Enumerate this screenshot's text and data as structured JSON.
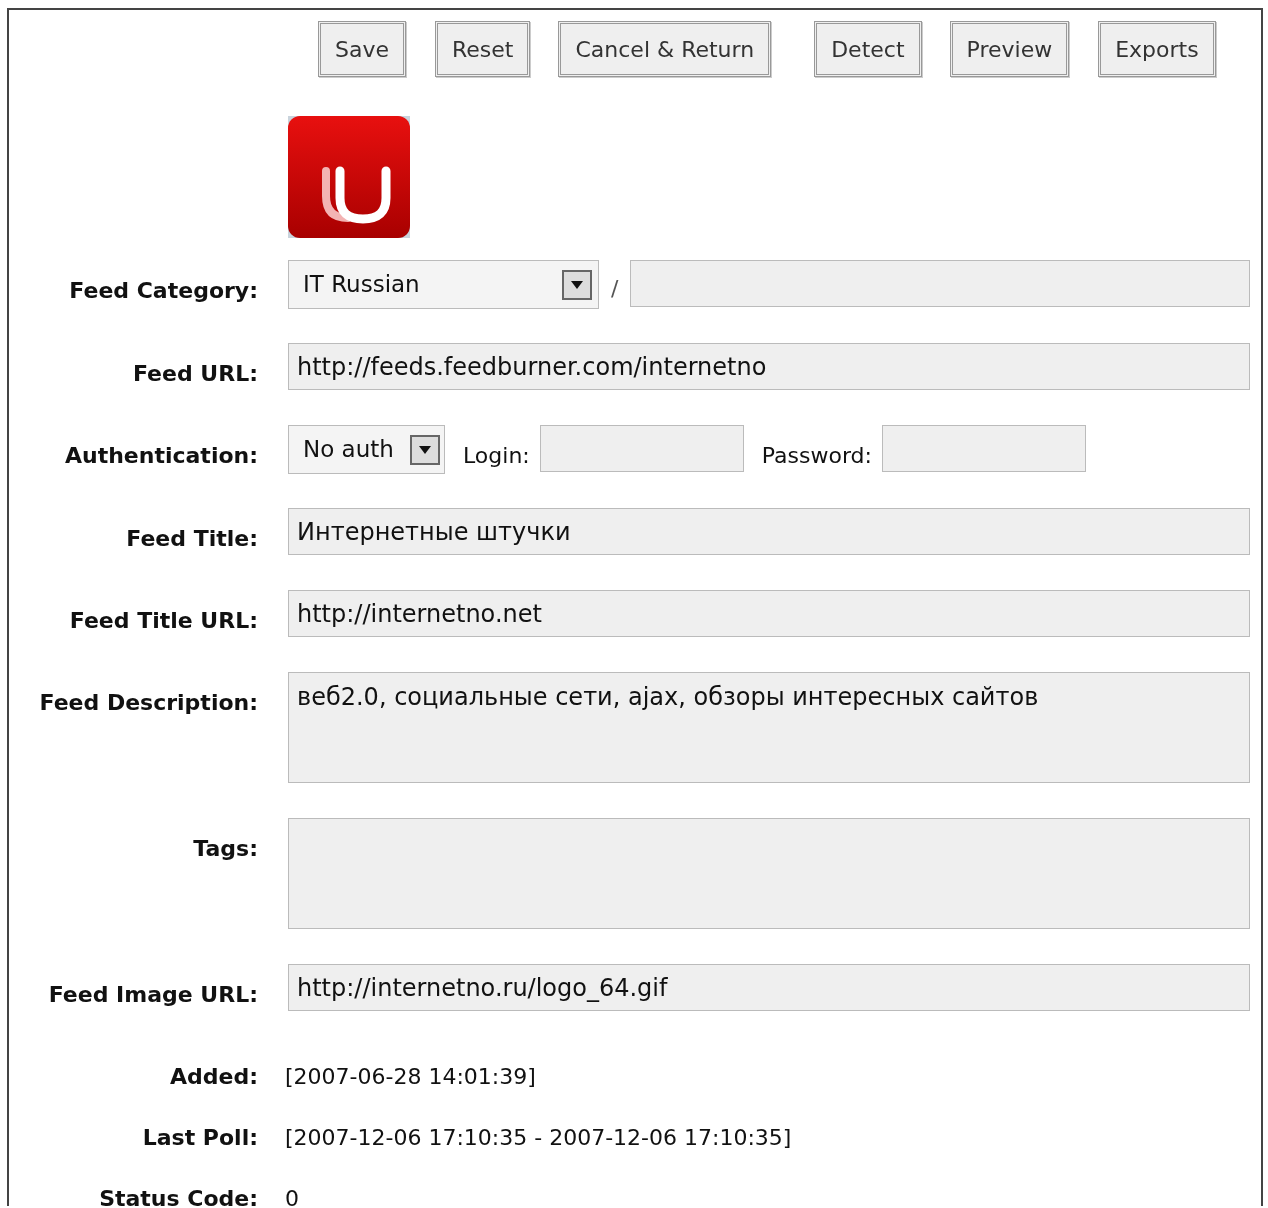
{
  "buttons": [
    "Save",
    "Reset",
    "Cancel & Return",
    "Detect",
    "Preview",
    "Exports"
  ],
  "fields": [
    {
      "kind": "category",
      "label": "Feed Category:",
      "value": "IT Russian",
      "separator": "/"
    },
    {
      "kind": "text",
      "label": "Feed URL:",
      "value": "http://feeds.feedburner.com/internetno"
    },
    {
      "kind": "auth",
      "label": "Authentication:",
      "value": "No auth",
      "login_label": "Login:",
      "password_label": "Password:"
    },
    {
      "kind": "text",
      "label": "Feed Title:",
      "value": "Интернетные штучки"
    },
    {
      "kind": "text",
      "label": "Feed Title URL:",
      "value": "http://internetno.net"
    },
    {
      "kind": "area",
      "label": "Feed Description:",
      "value": "веб2.0, социальные сети, ajax, обзоры интересных сайтов"
    },
    {
      "kind": "area",
      "label": "Tags:"
    },
    {
      "kind": "text",
      "label": "Feed Image URL:",
      "value": "http://internetno.ru/logo_64.gif"
    },
    {
      "kind": "info",
      "label": "Added:",
      "value": "[2007-06-28 14:01:39]"
    },
    {
      "kind": "info",
      "label": "Last Poll:",
      "value": "[2007-12-06 17:10:35 - 2007-12-06 17:10:35]"
    },
    {
      "kind": "info",
      "label": "Status Code:",
      "value": "0"
    }
  ]
}
